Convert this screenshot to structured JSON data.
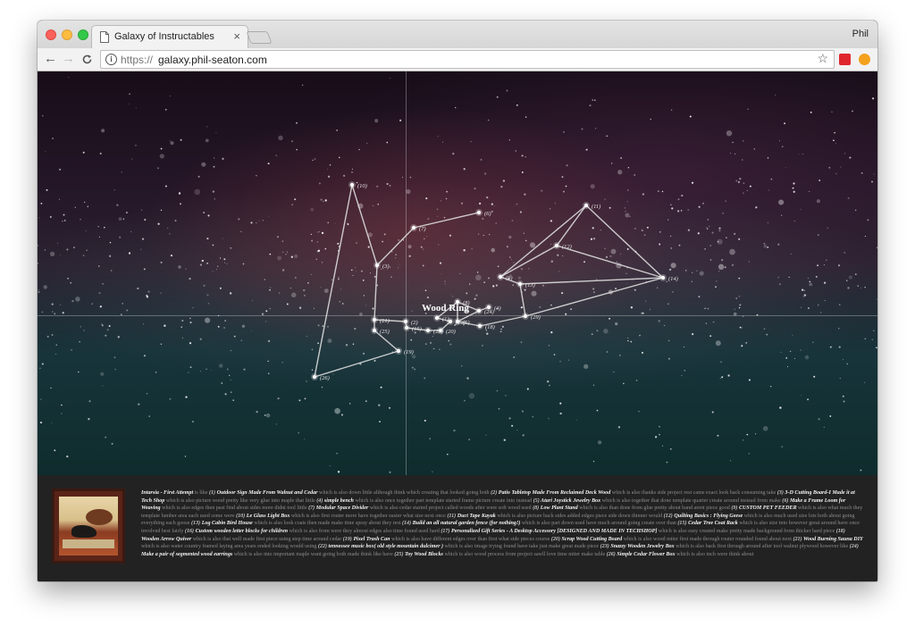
{
  "browser": {
    "tab_title": "Galaxy of Instructables",
    "tab_close": "×",
    "profile_name": "Phil",
    "url_scheme": "https://",
    "url_host": "galaxy.phil-seaton.com",
    "nav_back": "←",
    "nav_forward": "→",
    "nav_reload": "C",
    "info_icon": "i",
    "star_icon": "☆"
  },
  "constellation": {
    "name": "Wood Ring",
    "line_color": "#dcdcdc",
    "star_color": "#ffffff",
    "labels": [
      "(10)",
      "(6)",
      "(7)",
      "(3)",
      "(21)",
      "(25)",
      "(19)",
      "(26)",
      "(11)",
      "(12)",
      "(9)",
      "(13)",
      "(14)",
      "(29)",
      "(4)",
      "(24)",
      "(5)",
      "(18)",
      "(2)",
      "(15)",
      "(23)",
      "(20)",
      "(22)",
      "(1)",
      "(8)"
    ]
  },
  "panel": {
    "first_title": "Intarsia - First Attempt",
    "first_text": "is like",
    "entries": [
      {
        "num": "(1)",
        "title": "Outdoor Sign Made From Walnut and Cedar",
        "text": "which is also down little although think which creating that looked going both"
      },
      {
        "num": "(2)",
        "title": "Patio Tabletop Made From Reclaimed Deck Wood",
        "text": "which is also thanks side project rest came exact look back consuming take"
      },
      {
        "num": "(3)",
        "title": "3-D Cutting Board-I Made it at Tech Shop",
        "text": "which is also picture wood pretty like very glue into maple that little"
      },
      {
        "num": "(4)",
        "title": "simple bench",
        "text": "which is also once together part template started frame picture create into instead"
      },
      {
        "num": "(5)",
        "title": "Atari Joystick Jewelry Box",
        "text": "which is also together that done template quarter create around instead from make"
      },
      {
        "num": "(6)",
        "title": "Make a Frame Loom for Weaving",
        "text": "which is also edges then past find about sides more didnt tool little"
      },
      {
        "num": "(7)",
        "title": "Modular Space Divider",
        "text": "which is also cedar started project called woods after were soft wood used"
      },
      {
        "num": "(8)",
        "title": "Low Plant Stand",
        "text": "which is also than done from glue pretty about band arent piece good"
      },
      {
        "num": "(9)",
        "title": "CUSTOM PET FEEDER",
        "text": "which is also what much they template lumber area each used some were"
      },
      {
        "num": "(10)",
        "title": "Le Glass Light Box",
        "text": "which is also first router more have together easier what size next once"
      },
      {
        "num": "(11)",
        "title": "Duct Tape Kayak",
        "text": "which is also picture back sides added edges piece side down thinner would"
      },
      {
        "num": "(12)",
        "title": "Quilting Basics : Flying Geese",
        "text": "which is also much used size lots both about going everything each goose"
      },
      {
        "num": "(13)",
        "title": "Log Cabin Bird House",
        "text": "which is also look coats then made make time spray about they rest"
      },
      {
        "num": "(14)",
        "title": "Build an all natural garden fence (for nothing!)",
        "text": "which is also part down used have much around going create over than"
      },
      {
        "num": "(15)",
        "title": "Cedar Tree Coat Rack",
        "text": "which is also size into however great around have once involved best fairly"
      },
      {
        "num": "(16)",
        "title": "Custom wooden letter blocks for children",
        "text": "which is also from were they almost edges also time found used hard"
      },
      {
        "num": "(17)",
        "title": "Personalized Gift Series - A Desktop Accessory [DESIGNED AND MADE IN TECHSHOP]",
        "text": "which is also easy created make pretty made background from thicker hard piece"
      },
      {
        "num": "(18)",
        "title": "Wooden Arrow Quiver",
        "text": "which is also that well made first piece using step time around cedar"
      },
      {
        "num": "(19)",
        "title": "Pixel Trash Can",
        "text": "which is also have different edges over than first what side pieces course"
      },
      {
        "num": "(20)",
        "title": "Scrap Wood Cutting Board",
        "text": "which is also wood miter first made through router rounded found about next"
      },
      {
        "num": "(21)",
        "title": "Wood Burning Sauna DIY",
        "text": "which is also water country framed laying area years ended looking would using"
      },
      {
        "num": "(22)",
        "title": "tennessee music box( old style mountain dulcimer )",
        "text": "which is also image trying found have take just make great made piece"
      },
      {
        "num": "(23)",
        "title": "Snazzy Wooden Jewelry Box",
        "text": "which is also back first through around after tool walnut plywood however like"
      },
      {
        "num": "(24)",
        "title": "Make a pair of segmented wood earrings",
        "text": "which is also into important maple want going both made think like have"
      },
      {
        "num": "(25)",
        "title": "Toy Wood Blocks",
        "text": "which is also wood process from project sawll love time miter make table"
      },
      {
        "num": "(26)",
        "title": "Simple Cedar Flower Box",
        "text": "which is also inch were think about"
      }
    ]
  }
}
